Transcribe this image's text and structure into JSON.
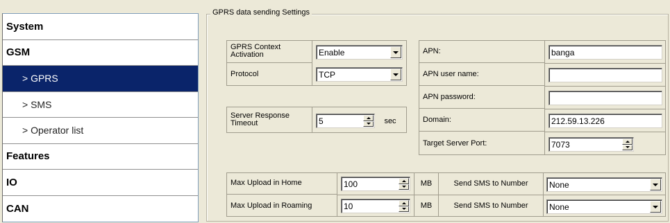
{
  "sidebar": {
    "items": [
      {
        "label": "System"
      },
      {
        "label": "GSM"
      },
      {
        "label": "> GPRS"
      },
      {
        "label": "> SMS"
      },
      {
        "label": "> Operator list"
      },
      {
        "label": "Features"
      },
      {
        "label": "IO"
      },
      {
        "label": "CAN"
      }
    ],
    "active_index": 2
  },
  "group_title": "GPRS  data sending Settings",
  "context": {
    "activation_label": "GPRS Context Activation",
    "activation_value": "Enable",
    "protocol_label": "Protocol",
    "protocol_value": "TCP"
  },
  "server_timeout": {
    "label": "Server Response Timeout",
    "value": "5",
    "unit": "sec"
  },
  "apn": {
    "apn_label": "APN:",
    "apn_value": "banga",
    "user_label": "APN user name:",
    "user_value": "",
    "password_label": "APN password:",
    "password_value": "",
    "domain_label": "Domain:",
    "domain_value": "212.59.13.226",
    "port_label": "Target Server Port:",
    "port_value": "7073"
  },
  "upload": {
    "home_label": "Max Upload in Home",
    "home_value": "100",
    "roaming_label": "Max Upload in Roaming",
    "roaming_value": "10",
    "unit": "MB",
    "sms_label": "Send SMS to Number",
    "sms_home_value": "None",
    "sms_roaming_value": "None"
  },
  "colors": {
    "active_item_bg": "#0a246a",
    "window_bg": "#ece9d8"
  }
}
